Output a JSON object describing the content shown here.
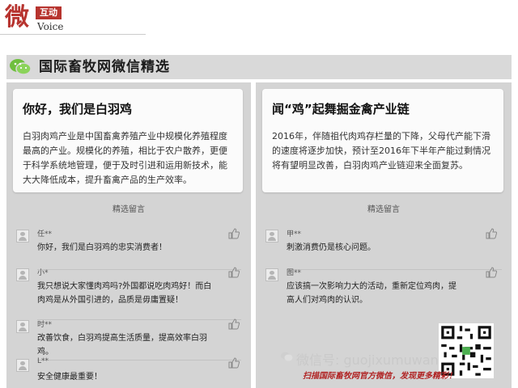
{
  "brand": {
    "char": "微",
    "tag": "互动",
    "voice": "Voice"
  },
  "banner": {
    "title": "国际畜牧网微信精选",
    "icon": "wechat-icon"
  },
  "left": {
    "card": {
      "title": "你好，我们是白羽鸡",
      "body": "白羽肉鸡产业是中国畜禽养殖产业中规模化养殖程度最高的产业。规模化的养殖，相比于农户散养，更便于科学系统地管理，便于及时引进和运用新技术，能大大降低成本，提升畜禽产品的生产效率。"
    },
    "comments_header": "精选留言",
    "comments": [
      {
        "name": "任**",
        "text": "你好，我们是白羽鸡的忠实消费者！"
      },
      {
        "name": "小*",
        "text": "我只想说大家懂肉鸡吗?外国都说吃肉鸡好！而白肉鸡是从外国引进的，品质是毋庸置疑！"
      },
      {
        "name": "时**",
        "text": "改善饮食，白羽鸡提高生活质量，提高效率白羽鸡。"
      },
      {
        "name": "L**",
        "text": "安全健康最重要！"
      }
    ]
  },
  "right": {
    "card": {
      "title": "闻“鸡”起舞掘金禽产业链",
      "body": "2016年，伴随祖代肉鸡存栏量的下降，父母代产能下滑的速度将逐步加快，预计至2016年下半年产能过剩情况将有望明显改善，白羽肉鸡产业链迎来全面复苏。"
    },
    "comments_header": "精选留言",
    "comments": [
      {
        "name": "甲**",
        "text": "刺激消费仍是核心问题。"
      },
      {
        "name": "图**",
        "text": "应该搞一次影响力大的活动，重新定位鸡肉，提高人们对鸡肉的认识。"
      }
    ]
  },
  "footer": {
    "wechat_id": "微信号: guojixumuwang",
    "scan_text": "扫描国际畜牧网官方微信，发现更多精彩！",
    "qr_icon": "qr-code-icon"
  },
  "colors": {
    "brand_red": "#b7342f",
    "panel_bg": "#d4d4d4",
    "banner_bg": "#d9d9d9",
    "scan_red": "#b02323"
  }
}
